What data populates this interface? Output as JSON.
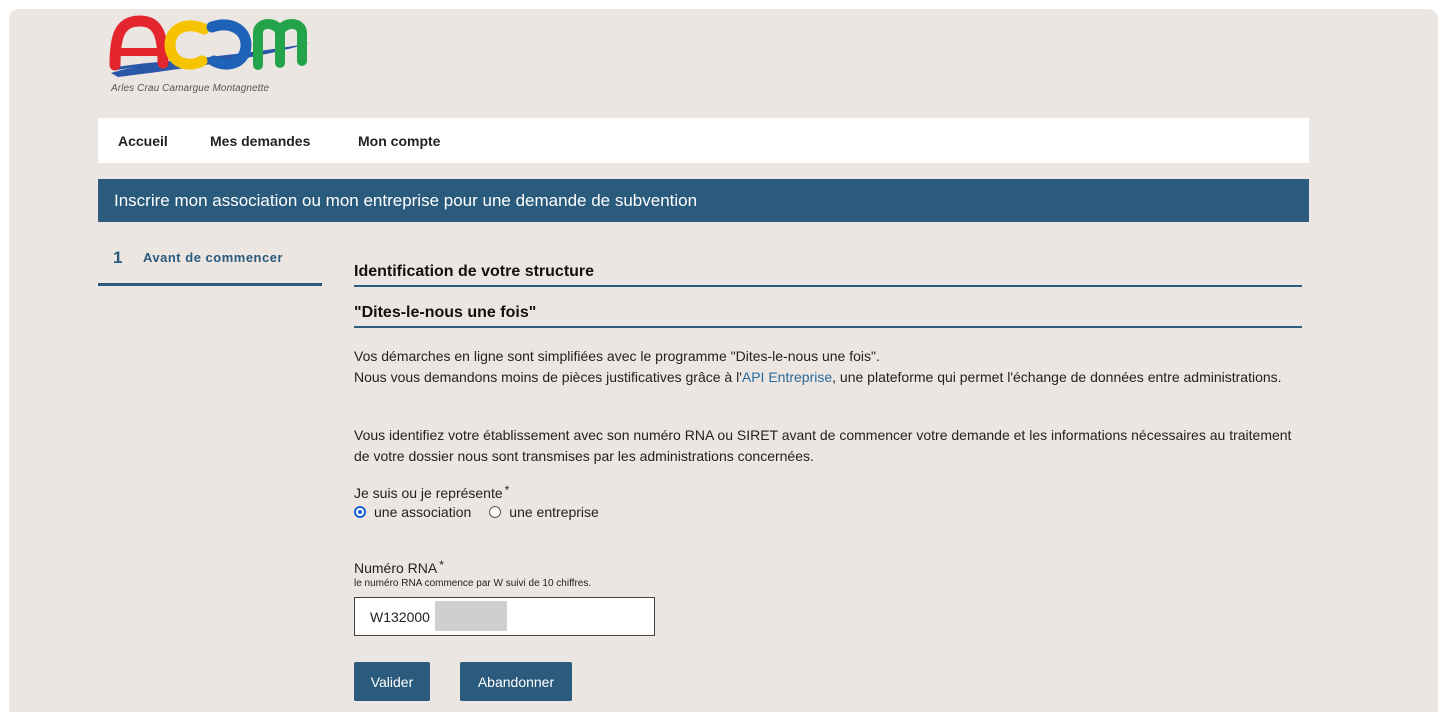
{
  "logo": {
    "letters": "acam",
    "caption": "Arles Crau Camargue Montagnette"
  },
  "nav": {
    "items": [
      {
        "label": "Accueil"
      },
      {
        "label": "Mes demandes"
      },
      {
        "label": "Mon compte"
      }
    ]
  },
  "banner": {
    "title": "Inscrire mon association ou mon entreprise pour une demande de subvention"
  },
  "steps": [
    {
      "number": "1",
      "label": "Avant de commencer"
    }
  ],
  "form": {
    "section1_title": "Identification de votre structure",
    "section2_title": "\"Dites-le-nous une fois\"",
    "intro_line1": "Vos démarches en ligne sont simplifiées avec le programme \"Dites-le-nous une fois\".",
    "intro_line2_pre": "Nous vous demandons moins de pièces justificatives grâce à l'",
    "intro_link": "API Entreprise",
    "intro_line2_post": ", une plateforme qui permet l'échange de données entre administrations.",
    "identify_text": "Vous identifiez votre établissement avec son numéro RNA ou SIRET avant de commencer votre demande et les informations nécessaires au traitement de votre dossier nous sont transmises par les administrations concernées.",
    "structure_label": "Je suis ou je représente",
    "required_mark": "*",
    "options": [
      {
        "label": "une association",
        "checked": true
      },
      {
        "label": "une entreprise",
        "checked": false
      }
    ],
    "rna_label": "Numéro RNA",
    "rna_hint": "le numéro RNA commence par W suivi de 10 chiffres.",
    "rna_value": "W132000",
    "validate_label": "Valider",
    "cancel_label": "Abandonner"
  },
  "colors": {
    "primary": "#2a5a7c",
    "background": "#ebe6e1",
    "link": "#2a6a9c",
    "radio_accent": "#1a5fd0"
  }
}
